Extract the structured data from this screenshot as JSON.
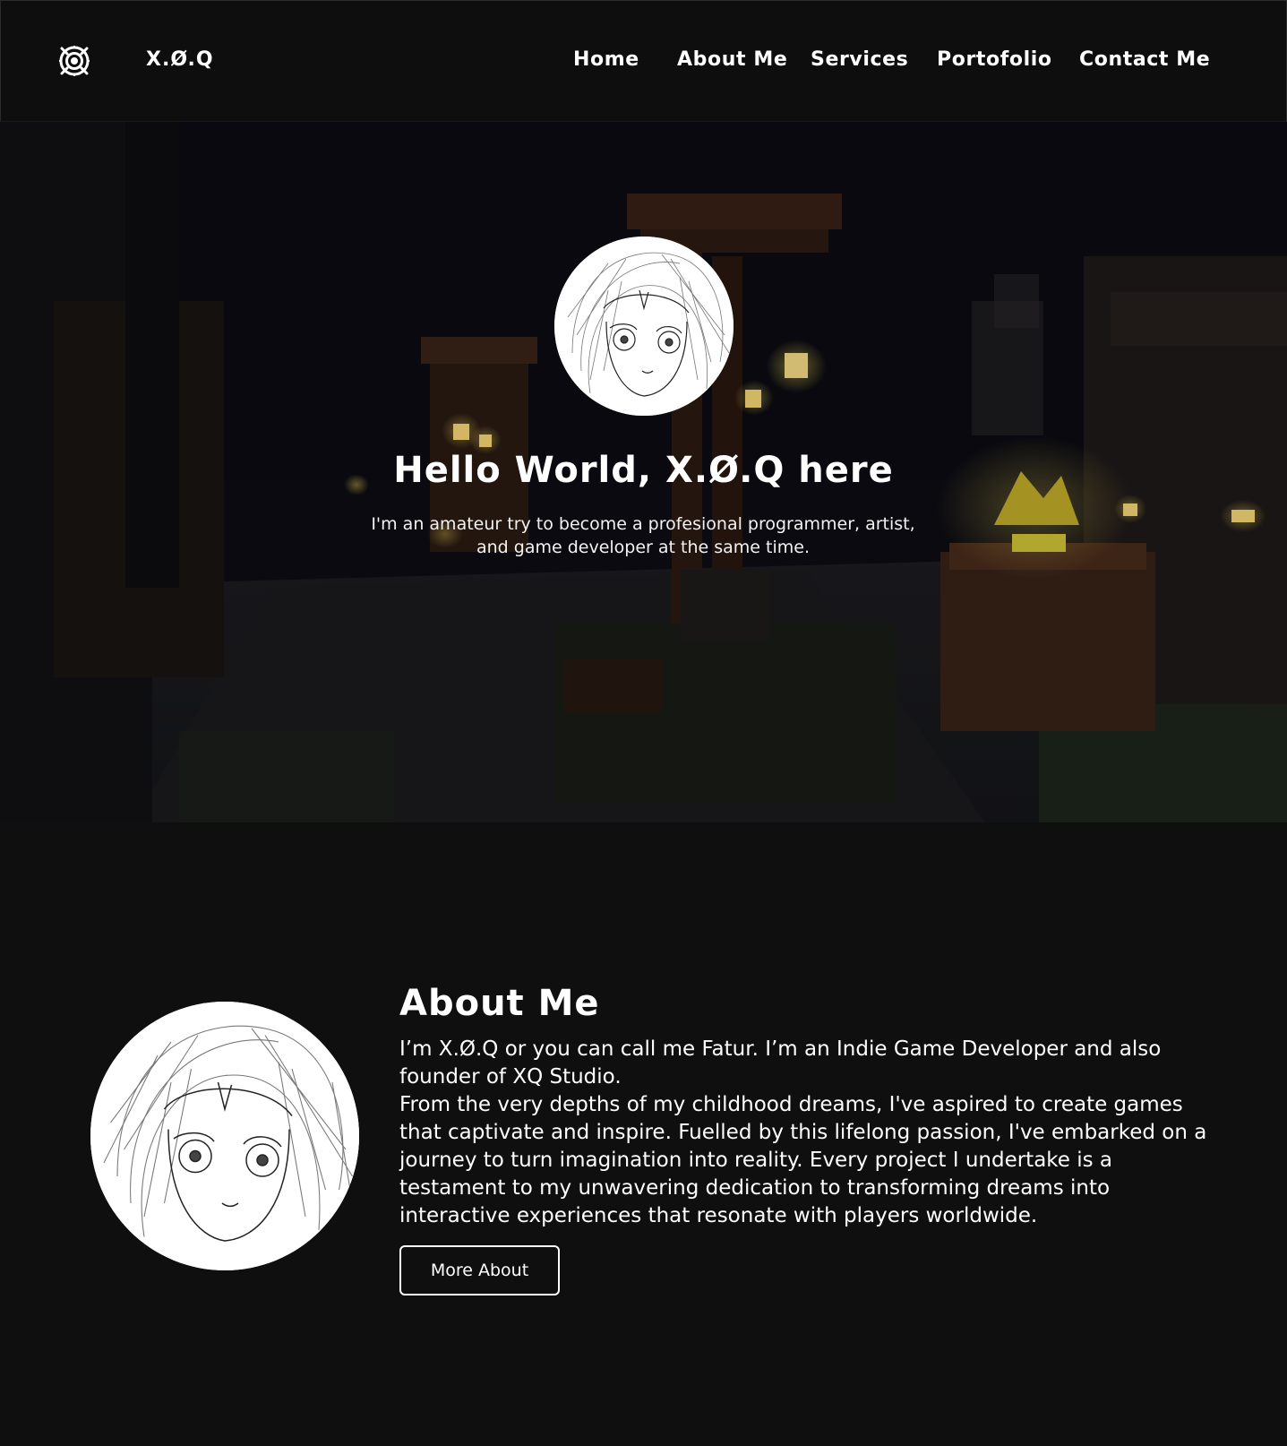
{
  "header": {
    "logo_icon": "target-gear-icon",
    "brand": "X.Ø.Q",
    "nav": [
      {
        "label": "Home"
      },
      {
        "label": "About Me"
      },
      {
        "label": "Services"
      },
      {
        "label": "Portofolio"
      },
      {
        "label": "Contact Me"
      }
    ]
  },
  "hero": {
    "avatar_icon": "anime-girl-sketch-avatar",
    "title": "Hello World, X.Ø.Q here",
    "subtitle": "I'm an amateur try to become a profesional programmer, artist, and game developer at the same time."
  },
  "about": {
    "avatar_icon": "anime-girl-sketch-avatar",
    "title": "About Me",
    "paragraph_1": "I’m X.Ø.Q or you can call me Fatur. I’m an Indie Game Developer and also founder of XQ Studio.",
    "paragraph_2": "From the very depths of my childhood dreams, I've aspired to create games that captivate and inspire. Fuelled by this lifelong passion, I've embarked on a journey to turn imagination into reality. Every project I undertake is a testament to my unwavering dedication to transforming dreams into interactive experiences that resonate with players worldwide.",
    "button_label": "More About"
  },
  "colors": {
    "page_background": "#0f0f0f",
    "header_background": "#0e0e0e",
    "text": "#ffffff",
    "torch_glow": "#ffd84a"
  }
}
